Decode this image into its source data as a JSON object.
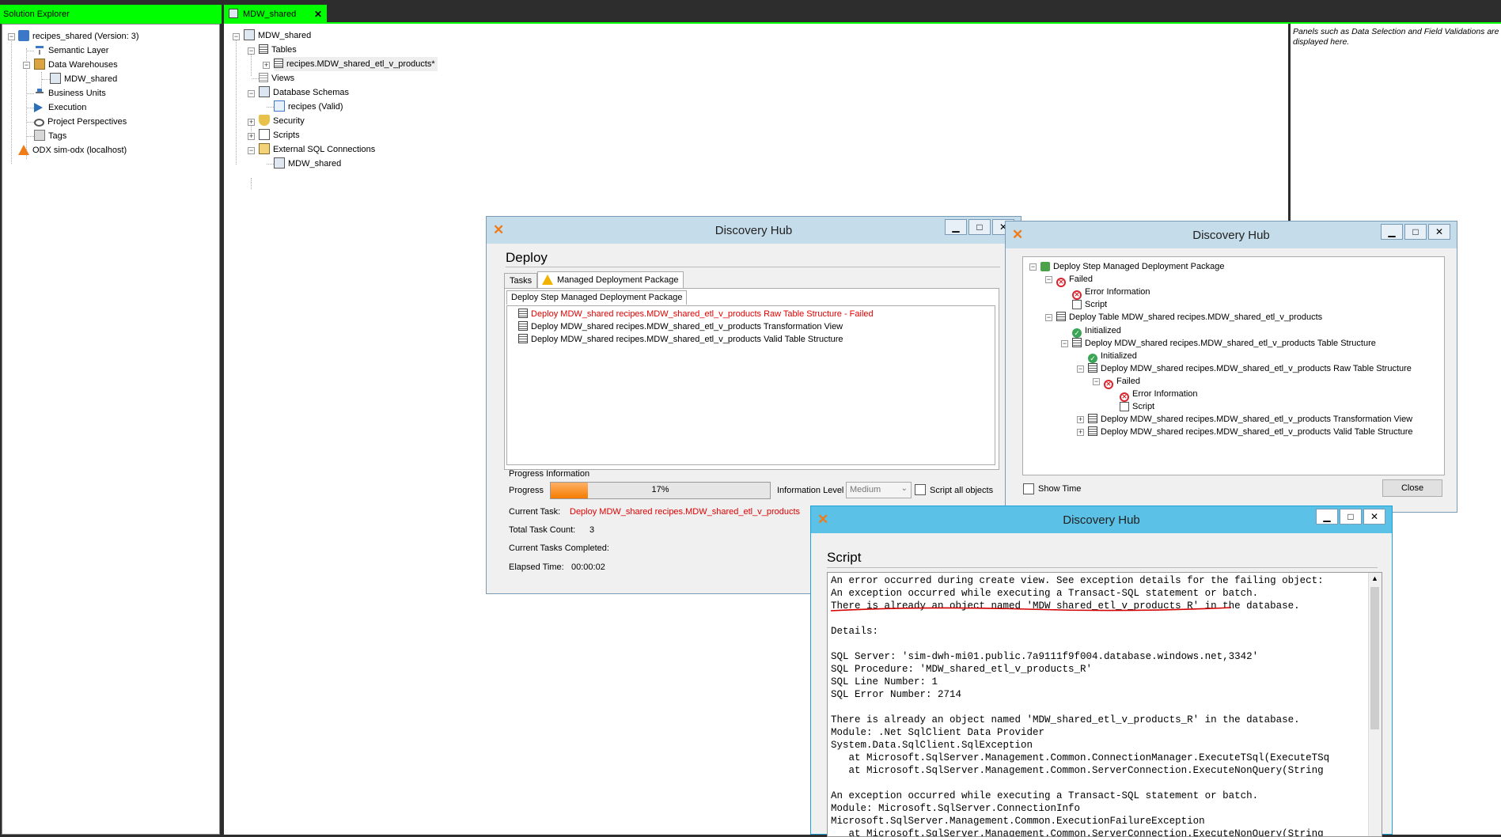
{
  "solution_explorer": {
    "title": "Solution Explorer",
    "items": [
      {
        "label": "recipes_shared (Version: 3)"
      },
      {
        "label": "Semantic Layer"
      },
      {
        "label": "Data Warehouses"
      },
      {
        "label": "MDW_shared"
      },
      {
        "label": "Business Units"
      },
      {
        "label": "Execution"
      },
      {
        "label": "Project Perspectives"
      },
      {
        "label": "Tags"
      },
      {
        "label": "ODX sim-odx (localhost)"
      }
    ]
  },
  "main_tab": {
    "label": "MDW_shared",
    "close": "✕"
  },
  "mdw_tree": {
    "items": [
      {
        "label": "MDW_shared"
      },
      {
        "label": "Tables"
      },
      {
        "label": "recipes.MDW_shared_etl_v_products*"
      },
      {
        "label": "Views"
      },
      {
        "label": "Database Schemas"
      },
      {
        "label": "recipes (Valid)"
      },
      {
        "label": "Security"
      },
      {
        "label": "Scripts"
      },
      {
        "label": "External SQL Connections"
      },
      {
        "label": "MDW_shared"
      }
    ]
  },
  "right_panel": {
    "note": "Panels such as Data Selection and Field Validations are displayed here."
  },
  "deploy_window": {
    "title": "Discovery Hub",
    "heading": "Deploy",
    "tabs": [
      {
        "label": "Tasks"
      },
      {
        "label": "Managed Deployment Package"
      }
    ],
    "subtab": "Deploy Step Managed Deployment Package",
    "tasks": [
      {
        "label": "Deploy MDW_shared recipes.MDW_shared_etl_v_products Raw Table Structure - Failed",
        "status": "failed"
      },
      {
        "label": "Deploy MDW_shared recipes.MDW_shared_etl_v_products Transformation View",
        "status": "ok"
      },
      {
        "label": "Deploy MDW_shared recipes.MDW_shared_etl_v_products Valid Table Structure",
        "status": "ok"
      }
    ],
    "progress_group": "Progress Information",
    "progress_label": "Progress",
    "progress_value": 17,
    "progress_text": "17%",
    "info_level_label": "Information Level",
    "info_level_value": "Medium",
    "script_all_label": "Script all objects",
    "current_task_label": "Current Task:",
    "current_task_value": "Deploy MDW_shared recipes.MDW_shared_etl_v_products",
    "total_task_label": "Total Task Count:",
    "total_task_value": "3",
    "completed_label": "Current Tasks Completed:",
    "elapsed_label": "Elapsed Time:",
    "elapsed_value": "00:00:02"
  },
  "detail_window": {
    "title": "Discovery Hub",
    "tree": [
      {
        "label": "Deploy Step Managed Deployment Package",
        "icon": "package"
      },
      {
        "label": "Failed",
        "icon": "error"
      },
      {
        "label": "Error Information",
        "icon": "error"
      },
      {
        "label": "Script",
        "icon": "page"
      },
      {
        "label": "Deploy Table MDW_shared recipes.MDW_shared_etl_v_products",
        "icon": "table"
      },
      {
        "label": "Initialized",
        "icon": "check"
      },
      {
        "label": "Deploy MDW_shared recipes.MDW_shared_etl_v_products Table Structure",
        "icon": "table"
      },
      {
        "label": "Initialized",
        "icon": "check"
      },
      {
        "label": "Deploy MDW_shared recipes.MDW_shared_etl_v_products Raw Table Structure",
        "icon": "table"
      },
      {
        "label": "Failed",
        "icon": "error"
      },
      {
        "label": "Error Information",
        "icon": "error"
      },
      {
        "label": "Script",
        "icon": "page"
      },
      {
        "label": "Deploy MDW_shared recipes.MDW_shared_etl_v_products Transformation View",
        "icon": "table"
      },
      {
        "label": "Deploy MDW_shared recipes.MDW_shared_etl_v_products Valid Table Structure",
        "icon": "table"
      }
    ],
    "show_time_label": "Show Time",
    "close_label": "Close"
  },
  "script_window": {
    "title": "Discovery Hub",
    "heading": "Script",
    "lines": [
      "An error occurred during create view. See exception details for the failing object:",
      "An exception occurred while executing a Transact-SQL statement or batch.",
      "There is already an object named 'MDW_shared_etl_v_products_R' in the database.",
      "",
      "Details:",
      "",
      "SQL Server: 'sim-dwh-mi01.public.7a9111f9f004.database.windows.net,3342'",
      "SQL Procedure: 'MDW_shared_etl_v_products_R'",
      "SQL Line Number: 1",
      "SQL Error Number: 2714",
      "",
      "There is already an object named 'MDW_shared_etl_v_products_R' in the database.",
      "Module: .Net SqlClient Data Provider",
      "System.Data.SqlClient.SqlException",
      "   at Microsoft.SqlServer.Management.Common.ConnectionManager.ExecuteTSql(ExecuteTSq",
      "   at Microsoft.SqlServer.Management.Common.ServerConnection.ExecuteNonQuery(String",
      "",
      "An exception occurred while executing a Transact-SQL statement or batch.",
      "Module: Microsoft.SqlServer.ConnectionInfo",
      "Microsoft.SqlServer.Management.Common.ExecutionFailureException",
      "   at Microsoft.SqlServer.Management.Common.ServerConnection.ExecuteNonQuery(String"
    ]
  },
  "window_buttons": {
    "minimize": "▁",
    "maximize": "□",
    "close": "✕"
  },
  "colors": {
    "accent_green": "#00ff00",
    "error_red": "#e00000",
    "logo_orange": "#f07b19",
    "progress_orange": "#f57c00"
  }
}
